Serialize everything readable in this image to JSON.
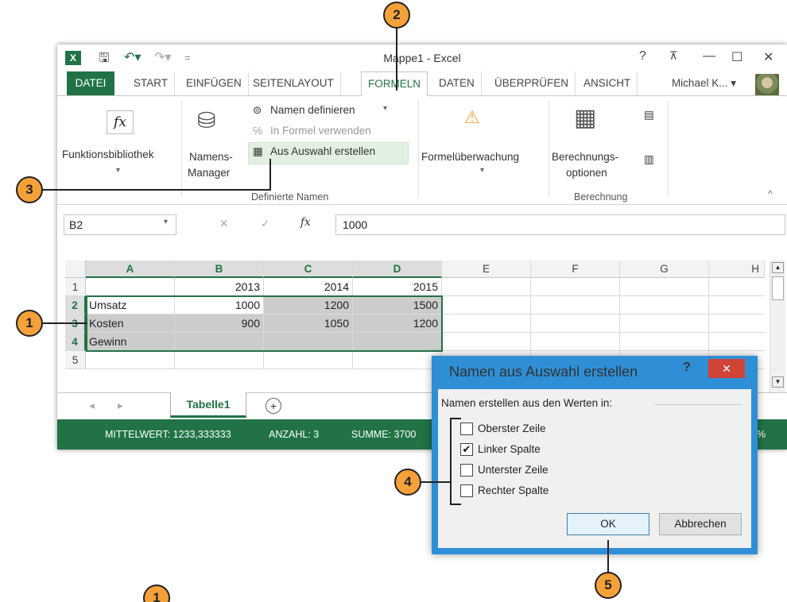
{
  "window": {
    "title": "Mappe1 - Excel",
    "help": "?",
    "ribbon_toggle": "⊼",
    "minimize": "—",
    "maximize": "☐",
    "close": "✕"
  },
  "tabs": [
    "DATEI",
    "START",
    "EINFÜGEN",
    "SEITENLAYOUT",
    "FORMELN",
    "DATEN",
    "ÜBERPRÜFEN",
    "ANSICHT"
  ],
  "user": "Michael K... ▾",
  "ribbon": {
    "funktionsbibliothek": "Funktionsbibliothek",
    "namens": "Namens-",
    "manager": "Manager",
    "namen_definieren": "Namen definieren",
    "in_formel": "In Formel verwenden",
    "aus_auswahl": "Aus Auswahl erstellen",
    "definierte_namen": "Definierte Namen",
    "formelueberwachung": "Formelüberwachung",
    "berechnungs": "Berechnungs-",
    "optionen": "optionen",
    "berechnung": "Berechnung"
  },
  "formula_bar": {
    "name_box": "B2",
    "fx": "fx",
    "value": "1000"
  },
  "columns": [
    "A",
    "B",
    "C",
    "D",
    "E",
    "F",
    "G",
    "H"
  ],
  "rows": [
    {
      "num": "1",
      "a": "",
      "b": "2013",
      "c": "2014",
      "d": "2015"
    },
    {
      "num": "2",
      "a": "Umsatz",
      "b": "1000",
      "c": "1200",
      "d": "1500"
    },
    {
      "num": "3",
      "a": "Kosten",
      "b": "900",
      "c": "1050",
      "d": "1200"
    },
    {
      "num": "4",
      "a": "Gewinn",
      "b": "",
      "c": "",
      "d": ""
    },
    {
      "num": "5",
      "a": "",
      "b": "",
      "c": "",
      "d": ""
    }
  ],
  "sheet_tab": "Tabelle1",
  "status": {
    "mittelwert": "MITTELWERT: 1233,333333",
    "anzahl": "ANZAHL: 3",
    "summe": "SUMME: 3700",
    "zoom": "%"
  },
  "dialog": {
    "title": "Namen aus Auswahl erstellen",
    "help": "?",
    "close": "✕",
    "legend": "Namen erstellen aus den Werten in:",
    "options": [
      {
        "label": "Oberster Zeile",
        "checked": false
      },
      {
        "label": "Linker Spalte",
        "checked": true
      },
      {
        "label": "Unterster Zeile",
        "checked": false
      },
      {
        "label": "Rechter Spalte",
        "checked": false
      }
    ],
    "ok": "OK",
    "cancel": "Abbrechen"
  },
  "callouts": [
    "1",
    "2",
    "3",
    "4",
    "5",
    "1"
  ]
}
